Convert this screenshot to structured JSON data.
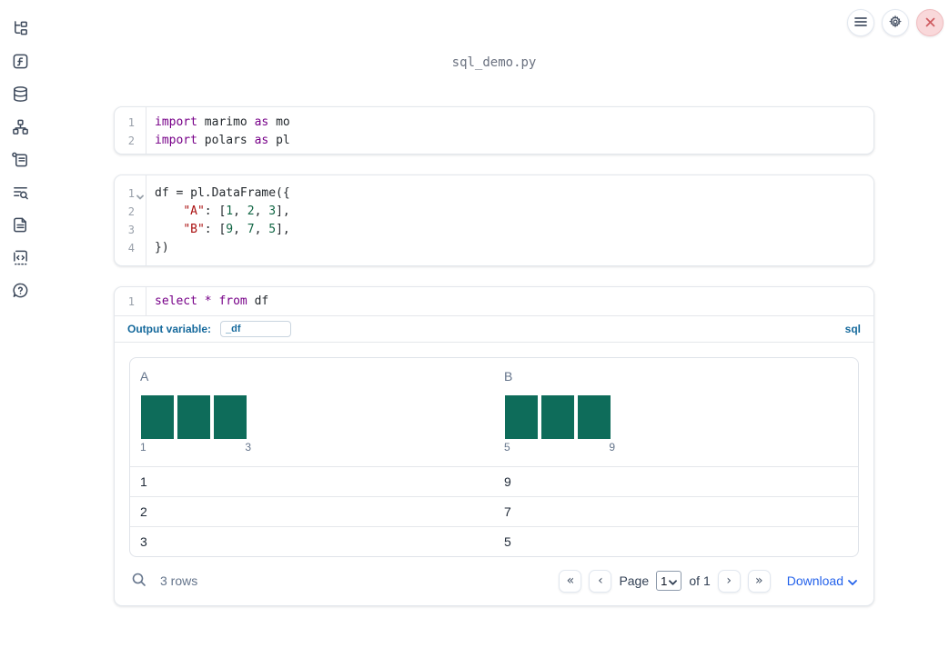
{
  "header": {
    "title": "sql_demo.py",
    "controls": [
      {
        "name": "menu-button",
        "icon": "hamburger-icon"
      },
      {
        "name": "settings-button",
        "icon": "gear-icon"
      },
      {
        "name": "shutdown-button",
        "icon": "close-x-icon"
      }
    ]
  },
  "sidebar": {
    "items": [
      {
        "icon": "file-tree-icon"
      },
      {
        "icon": "function-icon"
      },
      {
        "icon": "database-icon"
      },
      {
        "icon": "dependency-graph-icon"
      },
      {
        "icon": "scroll-icon"
      },
      {
        "icon": "logs-search-icon"
      },
      {
        "icon": "document-icon"
      },
      {
        "icon": "snippets-icon"
      },
      {
        "icon": "help-icon"
      }
    ]
  },
  "cells": [
    {
      "id": "imports",
      "lines": [
        {
          "num": "1",
          "tokens": [
            {
              "c": "kw",
              "t": "import"
            },
            {
              "c": "pl",
              "t": " marimo "
            },
            {
              "c": "kw",
              "t": "as"
            },
            {
              "c": "pl",
              "t": " mo"
            }
          ]
        },
        {
          "num": "2",
          "tokens": [
            {
              "c": "kw",
              "t": "import"
            },
            {
              "c": "pl",
              "t": " polars "
            },
            {
              "c": "kw",
              "t": "as"
            },
            {
              "c": "pl",
              "t": " pl"
            }
          ]
        }
      ]
    },
    {
      "id": "dataframe",
      "lines": [
        {
          "num": "1",
          "tokens": [
            {
              "c": "pl",
              "t": "df = pl.DataFrame({"
            }
          ]
        },
        {
          "num": "2",
          "tokens": [
            {
              "c": "pl",
              "t": "    "
            },
            {
              "c": "str",
              "t": "\"A\""
            },
            {
              "c": "pl",
              "t": ": ["
            },
            {
              "c": "num",
              "t": "1"
            },
            {
              "c": "pl",
              "t": ", "
            },
            {
              "c": "num",
              "t": "2"
            },
            {
              "c": "pl",
              "t": ", "
            },
            {
              "c": "num",
              "t": "3"
            },
            {
              "c": "pl",
              "t": "],"
            }
          ]
        },
        {
          "num": "3",
          "tokens": [
            {
              "c": "pl",
              "t": "    "
            },
            {
              "c": "str",
              "t": "\"B\""
            },
            {
              "c": "pl",
              "t": ": ["
            },
            {
              "c": "num",
              "t": "9"
            },
            {
              "c": "pl",
              "t": ", "
            },
            {
              "c": "num",
              "t": "7"
            },
            {
              "c": "pl",
              "t": ", "
            },
            {
              "c": "num",
              "t": "5"
            },
            {
              "c": "pl",
              "t": "],"
            }
          ]
        },
        {
          "num": "4",
          "tokens": [
            {
              "c": "pl",
              "t": "})"
            }
          ]
        }
      ]
    }
  ],
  "sql_cell": {
    "line_num": "1",
    "tokens": [
      {
        "c": "kw",
        "t": "select"
      },
      {
        "c": "pl",
        "t": " "
      },
      {
        "c": "kw",
        "t": "*"
      },
      {
        "c": "pl",
        "t": " "
      },
      {
        "c": "kw",
        "t": "from"
      },
      {
        "c": "pl",
        "t": " df"
      }
    ],
    "output_variable_label": "Output variable:",
    "output_variable_value": "_df",
    "language_badge": "sql"
  },
  "table": {
    "columns": [
      {
        "label": "A",
        "hist": {
          "bars": [
            1,
            1,
            1
          ],
          "min_label": "1",
          "max_label": "3"
        }
      },
      {
        "label": "B",
        "hist": {
          "bars": [
            1,
            1,
            1
          ],
          "min_label": "5",
          "max_label": "9"
        }
      }
    ],
    "rows": [
      [
        "1",
        "9"
      ],
      [
        "2",
        "7"
      ],
      [
        "3",
        "5"
      ]
    ],
    "footer": {
      "row_count": "3 rows",
      "page_label": "Page",
      "page_value": "1",
      "of_label": "of 1",
      "download_label": "Download",
      "pager": {
        "first": "«",
        "prev": "‹",
        "next": "›",
        "last": "»"
      }
    }
  },
  "colors": {
    "accent_blue": "#2563eb",
    "sql_blue": "#15699c",
    "hist_teal": "#0e6c5a",
    "keyword": "#770088",
    "string": "#aa1111",
    "number": "#116644",
    "danger_bg": "#f9d8da"
  }
}
